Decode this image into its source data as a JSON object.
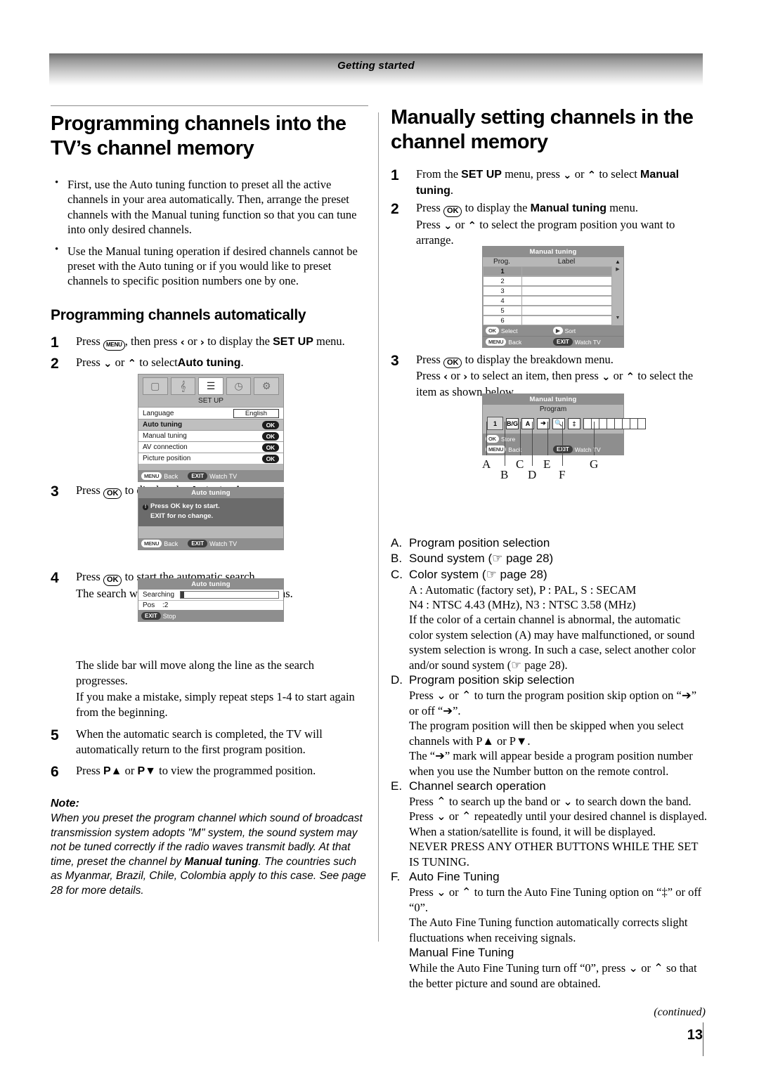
{
  "header": {
    "running_head": "Getting started"
  },
  "left": {
    "title": "Programming channels into the TV’s channel memory",
    "bullets": [
      "First, use the Auto tuning function to preset all the active channels in your area automatically. Then, arrange the preset channels with the Manual tuning function so that you can tune into only desired channels.",
      "Use the Manual tuning operation if desired channels cannot be preset with the Auto tuning or if you would like to preset channels to specific position numbers one by one."
    ],
    "subhead": "Programming channels automatically",
    "steps": {
      "s1_num": "1",
      "s1_a": "Press",
      "s1_key": "MENU",
      "s1_b": ", then press",
      "s1_lt": "‹",
      "s1_or": "or",
      "s1_gt": "›",
      "s1_c": "to display the",
      "s1_menu": "SET UP",
      "s1_d": "menu.",
      "s2_num": "2",
      "s2_a": "Press",
      "s2_down": "⌄",
      "s2_or": "or",
      "s2_up": "⌃",
      "s2_b": "to select",
      "s2_item": "Auto tuning",
      "s2_c": ".",
      "s3_num": "3",
      "s3_a": "Press",
      "s3_key": "OK",
      "s3_b": "to display the",
      "s3_item": "Auto tuning",
      "s3_c": "menu.",
      "s4_num": "4",
      "s4_a": "Press",
      "s4_key": "OK",
      "s4_b": "to start the automatic search.",
      "s4_line2": "The search will begin for all available stations.",
      "after4_l1": "The slide bar will move along the line as the search progresses.",
      "after4_l2": "If you make a mistake, simply repeat steps 1-4 to start again from the beginning.",
      "s5_num": "5",
      "s5_text": "When the automatic search is completed, the TV will automatically return to the first program position.",
      "s6_num": "6",
      "s6_a": "Press",
      "s6_pup": "P▲",
      "s6_or": "or",
      "s6_pdn": "P▼",
      "s6_b": "to view the programmed position."
    },
    "note": {
      "label": "Note:",
      "line1": "When you preset the program channel which sound of broadcast transmission system adopts \"M\" system, the sound system may not be tuned correctly if the radio waves transmit badly. At that time, preset the channel by ",
      "bold": "Manual tuning",
      "line2": ". The countries such as Myanmar, Brazil, Chile, Colombia apply to this case. See page 28 for more details."
    }
  },
  "right": {
    "title": "Manually setting channels in the channel memory",
    "steps": {
      "s1_num": "1",
      "s1_a": "From the",
      "s1_menu": "SET UP",
      "s1_b": "menu, press",
      "s1_down": "⌄",
      "s1_or": "or",
      "s1_up": "⌃",
      "s1_c": "to select",
      "s1_item": "Manual tuning",
      "s1_d": ".",
      "s2_num": "2",
      "s2_a": "Press",
      "s2_key": "OK",
      "s2_b": "to display the",
      "s2_item": "Manual tuning",
      "s2_c": "menu.",
      "s2_line2a": "Press",
      "s2_line2b": "or",
      "s2_line2c": "to select the program position you want to arrange.",
      "s3_num": "3",
      "s3_a": "Press",
      "s3_key": "OK",
      "s3_b": "to display the breakdown menu.",
      "s3_line2a": "Press",
      "s3_lt": "‹",
      "s3_or": "or",
      "s3_gt": "›",
      "s3_line2b": "to select an item, then press",
      "s3_line2c": "to select the item as shown below."
    },
    "callout_letters": [
      "A",
      "B",
      "C",
      "D",
      "E",
      "F",
      "G"
    ],
    "items": [
      {
        "letter": "A.",
        "title": "Program position selection",
        "subs": []
      },
      {
        "letter": "B.",
        "title": "Sound system (☞ page 28)",
        "subs": []
      },
      {
        "letter": "C.",
        "title": "Color system (☞ page 28)",
        "subs": [
          "A : Automatic (factory set), P : PAL, S : SECAM",
          "N4 : NTSC 4.43 (MHz), N3 : NTSC 3.58 (MHz)",
          "If the color of a certain channel is abnormal, the automatic color system selection (A) may have malfunctioned, or sound system selection is wrong. In such a case, select another color and/or sound system (☞ page 28)."
        ]
      },
      {
        "letter": "D.",
        "title": "Program position skip selection",
        "subs": [
          "Press ⌄ or ⌃ to turn the program position skip option on “➔” or off “➔”.",
          "The program position will then be skipped when you select channels with P▲ or P▼.",
          "The “➔” mark will appear beside a program position number when you use the Number button on the remote control."
        ]
      },
      {
        "letter": "E.",
        "title": "Channel search operation",
        "subs": [
          "Press ⌃ to search up the band or ⌄ to search down the band.",
          "Press ⌄ or ⌃ repeatedly until your desired channel is displayed.",
          "When a station/satellite is found, it will be displayed.",
          "NEVER PRESS ANY OTHER BUTTONS WHILE THE SET IS TUNING."
        ]
      },
      {
        "letter": "F.",
        "title": "Auto Fine Tuning",
        "subs": [
          "Press ⌄ or ⌃ to turn the Auto Fine Tuning option on “‡” or off “0”.",
          "The Auto Fine Tuning function automatically corrects slight fluctuations when receiving signals.",
          "Manual Fine Tuning",
          "While the Auto Fine Tuning turn off “0”, press ⌄ or ⌃ so that the better picture and sound are obtained."
        ]
      }
    ]
  },
  "osd": {
    "setup": {
      "title": "SET UP",
      "icons": [
        "picture-icon",
        "sound-icon",
        "setup-icon",
        "clock-icon",
        "tools-icon"
      ],
      "rows": [
        {
          "label": "Language",
          "value": "English",
          "type": "value"
        },
        {
          "label": "Auto tuning",
          "value": "OK",
          "type": "ok",
          "highlight": true
        },
        {
          "label": "Manual tuning",
          "value": "OK",
          "type": "ok"
        },
        {
          "label": "AV connection",
          "value": "OK",
          "type": "ok"
        },
        {
          "label": "Picture position",
          "value": "OK",
          "type": "ok"
        }
      ],
      "foot_menu_key": "MENU",
      "foot_menu_label": "Back",
      "foot_exit_key": "EXIT",
      "foot_exit_label": "Watch TV"
    },
    "auto_confirm": {
      "title": "Auto tuning",
      "msg_line1": "Press OK key to start.",
      "msg_line2": "EXIT for no change.",
      "foot_menu_key": "MENU",
      "foot_menu_label": "Back",
      "foot_exit_key": "EXIT",
      "foot_exit_label": "Watch TV"
    },
    "auto_search": {
      "title": "Auto tuning",
      "searching_label": "Searching",
      "pos_label": "Pos",
      "pos_value": ":2",
      "foot_exit_key": "EXIT",
      "foot_exit_label": "Stop"
    },
    "manual_table": {
      "title": "Manual tuning",
      "col_prog": "Prog.",
      "col_label": "Label",
      "rows": [
        "1",
        "2",
        "3",
        "4",
        "5",
        "6"
      ],
      "foot_ok_key": "OK",
      "foot_ok_label": "Select",
      "foot_sort_key": "▶",
      "foot_sort_label": "Sort",
      "foot_menu_key": "MENU",
      "foot_menu_label": "Back",
      "foot_exit_key": "EXIT",
      "foot_exit_label": "Watch TV"
    },
    "breakdown": {
      "title": "Manual tuning",
      "subtitle": "Program",
      "prog_value": "1",
      "sound_system": "B/G",
      "color_system": "A",
      "skip_icon": "skip-arrow-icon",
      "search_icon": "magnifier-icon",
      "fine_icon": "fine-tune-icon",
      "label_cells": 8,
      "foot_ok_key": "OK",
      "foot_ok_label": "Store",
      "foot_menu_key": "MENU",
      "foot_menu_label": "Back",
      "foot_exit_key": "EXIT",
      "foot_exit_label": "Watch TV"
    }
  },
  "footer": {
    "continued": "(continued)",
    "page": "13"
  }
}
